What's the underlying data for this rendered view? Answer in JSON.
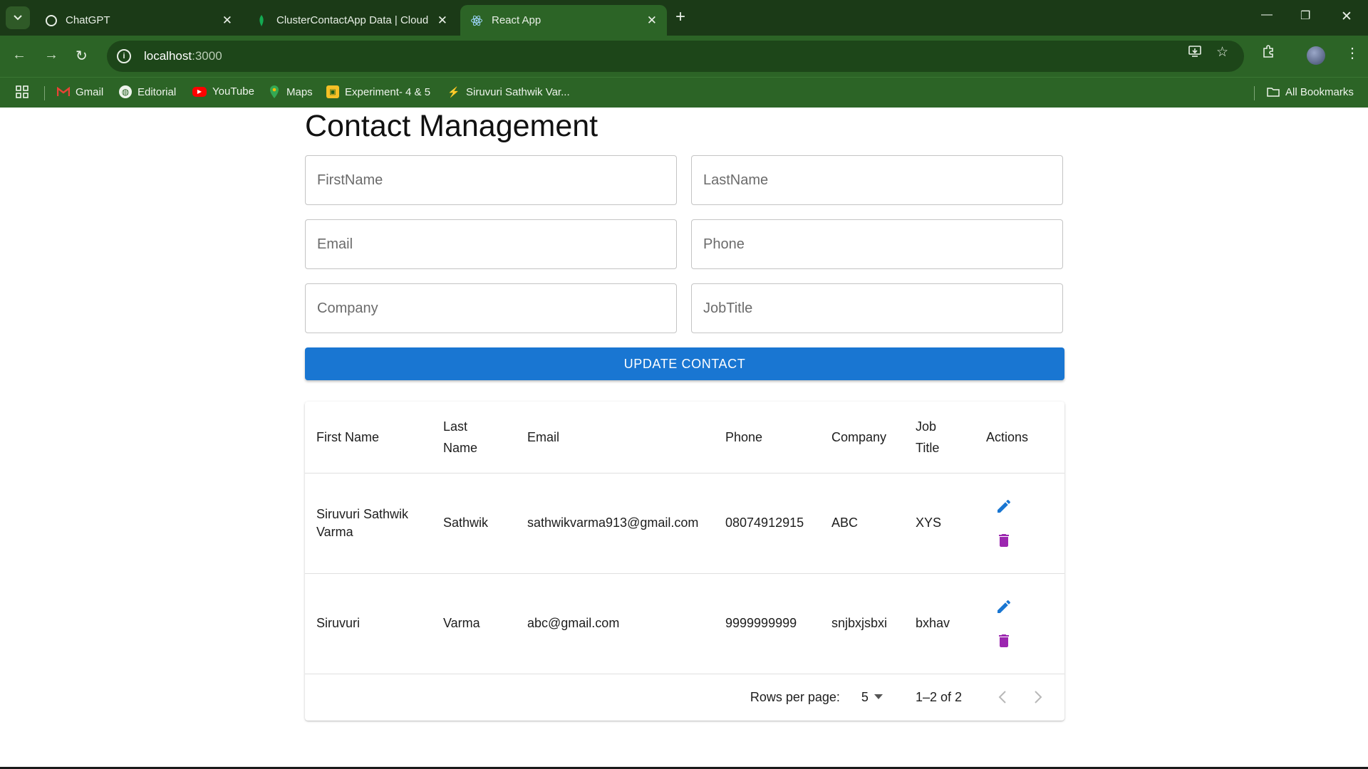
{
  "browser": {
    "tabs": [
      {
        "title": "ChatGPT",
        "active": false
      },
      {
        "title": "ClusterContactApp Data | Cloud",
        "active": false
      },
      {
        "title": "React App",
        "active": true
      }
    ],
    "url_host": "localhost",
    "url_port": ":3000",
    "bookmarks": [
      {
        "label": "Gmail",
        "icon": "gmail-icon"
      },
      {
        "label": "Editorial",
        "icon": "globe-icon"
      },
      {
        "label": "YouTube",
        "icon": "youtube-icon"
      },
      {
        "label": "Maps",
        "icon": "maps-icon"
      },
      {
        "label": "Experiment- 4 & 5",
        "icon": "classroom-icon"
      },
      {
        "label": "Siruvuri Sathwik Var...",
        "icon": "profile-icon"
      }
    ],
    "all_bookmarks": "All Bookmarks"
  },
  "page": {
    "title": "Contact Management",
    "form": {
      "firstname_placeholder": "FirstName",
      "lastname_placeholder": "LastName",
      "email_placeholder": "Email",
      "phone_placeholder": "Phone",
      "company_placeholder": "Company",
      "jobtitle_placeholder": "JobTitle",
      "submit_label": "UPDATE CONTACT"
    },
    "table": {
      "headers": {
        "first_name": "First Name",
        "last_name": "Last Name",
        "email": "Email",
        "phone": "Phone",
        "company": "Company",
        "job_title": "Job Title",
        "actions": "Actions"
      },
      "rows": [
        {
          "first_name": "Siruvuri Sathwik Varma",
          "last_name": "Sathwik",
          "email": "sathwikvarma913@gmail.com",
          "phone": "08074912915",
          "company": "ABC",
          "job_title": "XYS"
        },
        {
          "first_name": "Siruvuri",
          "last_name": "Varma",
          "email": "abc@gmail.com",
          "phone": "9999999999",
          "company": "snjbxjsbxi",
          "job_title": "bxhav"
        }
      ]
    },
    "pagination": {
      "rows_per_page_label": "Rows per page:",
      "rows_per_page_value": "5",
      "range": "1–2 of 2"
    }
  },
  "colors": {
    "primary": "#1976d2",
    "delete": "#9c27b0",
    "chrome_dark": "#1b3a17",
    "chrome": "#2c6426"
  }
}
